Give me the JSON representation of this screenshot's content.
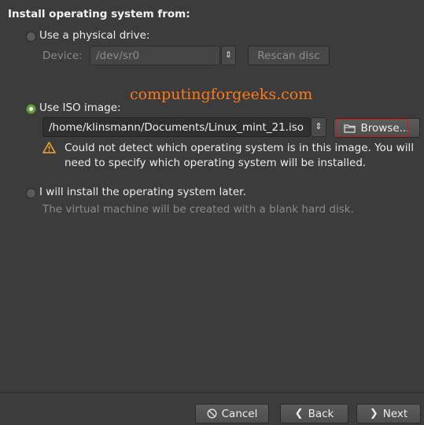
{
  "header": {
    "title": "Install operating system from:"
  },
  "physical": {
    "label": "Use a physical drive:",
    "device_label": "Device:",
    "device_value": "/dev/sr0",
    "rescan_label": "Rescan disc"
  },
  "iso": {
    "label": "Use ISO image:",
    "path": "/home/klinsmann/Documents/Linux_mint_21.iso",
    "browse_label": "Browse...",
    "warning_line1": "Could not detect which operating system is in this image. You will",
    "warning_line2": "need to specify which operating system will be installed."
  },
  "later": {
    "label": "I will install the operating system later.",
    "description": "The virtual machine will be created with a blank hard disk."
  },
  "watermark": "computingforgeeks.com",
  "footer": {
    "cancel_label": "Cancel",
    "back_label": "Back",
    "next_label": "Next"
  },
  "colors": {
    "accent": "#6ca045",
    "highlight": "#d11a1a",
    "watermark": "#ff7a1a",
    "warning": "#f0a830"
  }
}
